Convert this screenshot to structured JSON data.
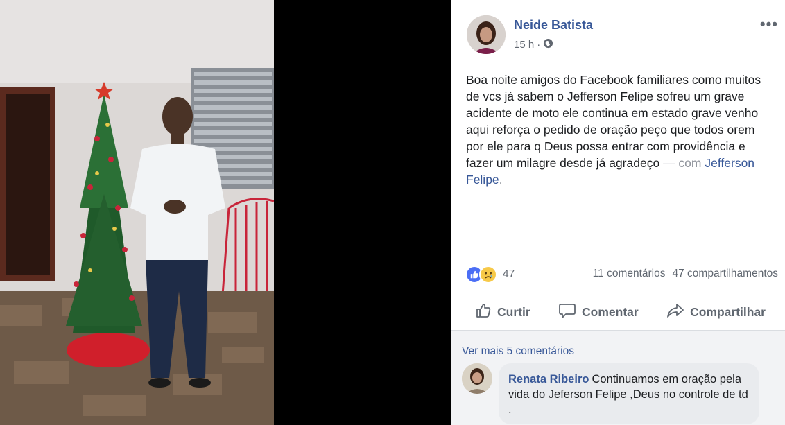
{
  "post": {
    "author": "Neide Batista",
    "time": "15 h",
    "separator": "·",
    "privacy_icon": "globe-icon",
    "more_label": "•••",
    "text": "Boa noite amigos do Facebook familiares como muitos de vcs já sabem o Jefferson Felipe sofreu um grave acidente de moto ele continua em estado grave venho aqui reforça o pedido de oração peço que todos orem por ele para q Deus possa entrar com providência e fazer um milagre desde já agradeço",
    "with_label": "— com",
    "tagged": "Jefferson Felipe",
    "tag_suffix": "."
  },
  "stats": {
    "reaction_icons": [
      "like-reaction-icon",
      "sad-reaction-icon"
    ],
    "reaction_count": "47",
    "comments": "11 comentários",
    "shares": "47 compartilhamentos"
  },
  "actions": {
    "like": "Curtir",
    "comment": "Comentar",
    "share": "Compartilhar"
  },
  "comments": {
    "view_more": "Ver mais 5 comentários",
    "items": [
      {
        "author": "Renata Ribeiro",
        "text": "Continuamos em oração pela vida do Jeferson Felipe ,Deus no controle de td ."
      }
    ]
  },
  "colors": {
    "link": "#385898",
    "like_blue": "#4b6ef5",
    "sad_yellow": "#f7c948"
  }
}
